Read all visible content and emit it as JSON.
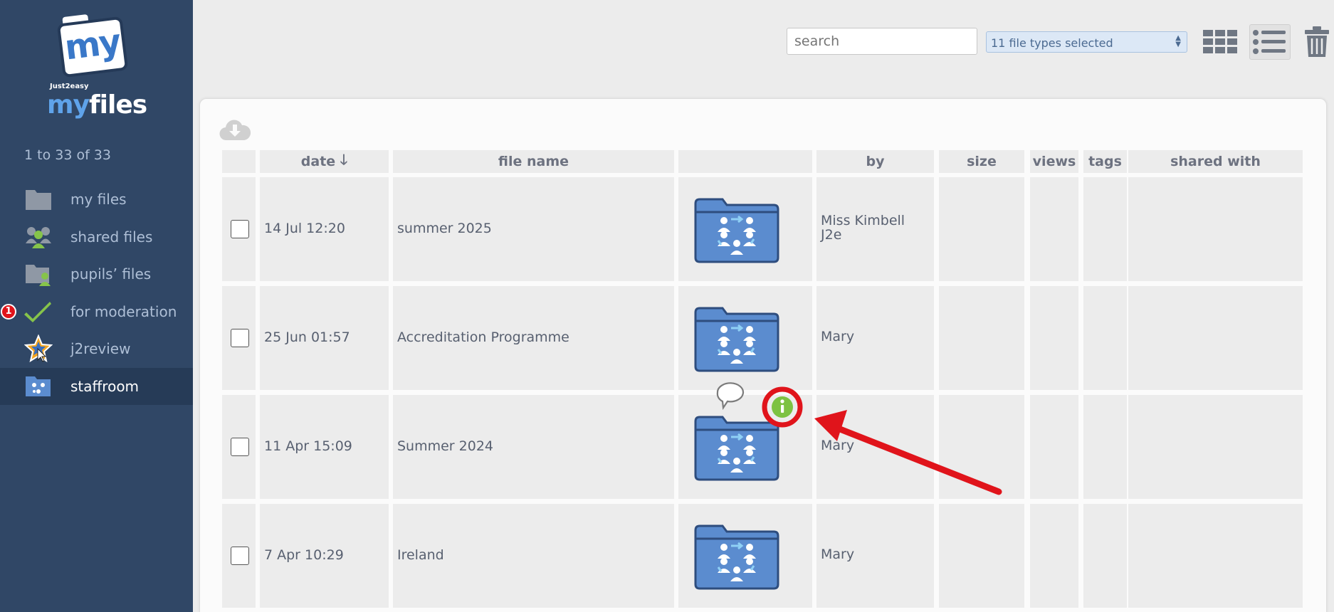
{
  "logo": {
    "my": "my",
    "just": "Just2easy",
    "my2": "my",
    "files": "files"
  },
  "sidebar": {
    "count": "1 to 33 of 33",
    "items": [
      {
        "label": "my files",
        "icon": "folder-icon"
      },
      {
        "label": "shared files",
        "icon": "people-icon"
      },
      {
        "label": "pupils’ files",
        "icon": "pupil-folder-icon"
      },
      {
        "label": "for moderation",
        "icon": "checkmark-icon",
        "badge": "1"
      },
      {
        "label": "j2review",
        "icon": "star-icon"
      },
      {
        "label": "staffroom",
        "icon": "staffroom-folder-icon"
      }
    ]
  },
  "toolbar": {
    "search_placeholder": "search",
    "file_types": "11 file types selected"
  },
  "table": {
    "headers": [
      "date",
      "file name",
      "by",
      "size",
      "views",
      "tags",
      "shared with"
    ],
    "rows": [
      {
        "date": "14 Jul 12:20",
        "name": "summer 2025",
        "by": "Miss Kimbell",
        "by2": "J2e"
      },
      {
        "date": "25 Jun 01:57",
        "name": "Accreditation Programme",
        "by": "Mary",
        "by2": ""
      },
      {
        "date": "11 Apr 15:09",
        "name": "Summer 2024",
        "by": "Mary",
        "by2": ""
      },
      {
        "date": "7 Apr 10:29",
        "name": "Ireland",
        "by": "Mary",
        "by2": ""
      }
    ]
  },
  "colors": {
    "sidebar": "#304766",
    "folder": "#5b8ccf",
    "annotation": "#e0141b",
    "info": "#7dc242"
  }
}
